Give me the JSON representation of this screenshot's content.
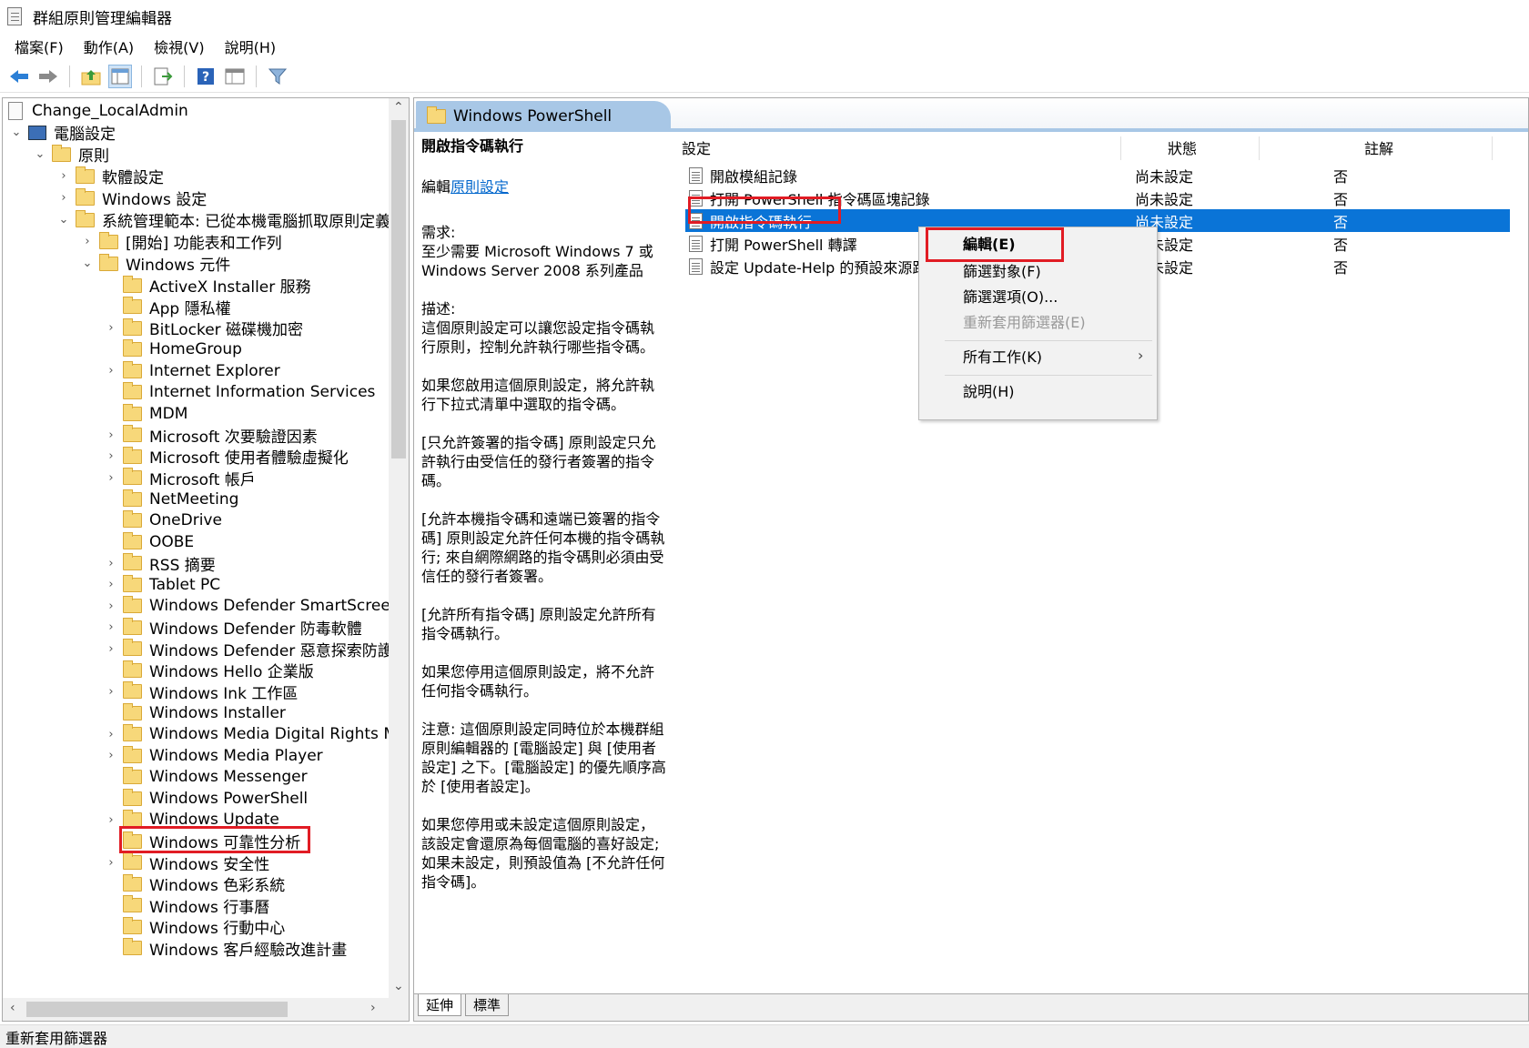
{
  "window": {
    "title": "群組原則管理編輯器"
  },
  "menu": {
    "items": [
      "檔案(F)",
      "動作(A)",
      "檢視(V)",
      "說明(H)"
    ]
  },
  "toolbar": {
    "buttons": [
      "back-icon",
      "forward-icon",
      "up-folder-icon",
      "show-hide-tree-icon",
      "export-list-icon",
      "help-icon",
      "properties-icon",
      "filter-icon"
    ]
  },
  "tree": {
    "root": "Change_LocalAdmin",
    "computer": "電腦設定",
    "policies": "原則",
    "software": "軟體設定",
    "windows_settings": "Windows 設定",
    "admin_templates": "系統管理範本: 已從本機電腦抓取原則定義",
    "start_menu": "[開始] 功能表和工作列",
    "windows_components": "Windows 元件",
    "components": [
      "ActiveX Installer 服務",
      "App 隱私權",
      "BitLocker 磁碟機加密",
      "HomeGroup",
      "Internet Explorer",
      "Internet Information Services",
      "MDM",
      "Microsoft 次要驗證因素",
      "Microsoft 使用者體驗虛擬化",
      "Microsoft 帳戶",
      "NetMeeting",
      "OneDrive",
      "OOBE",
      "RSS 摘要",
      "Tablet PC",
      "Windows Defender SmartScreen",
      "Windows Defender 防毒軟體",
      "Windows Defender 惡意探索防護",
      "Windows Hello 企業版",
      "Windows Ink 工作區",
      "Windows Installer",
      "Windows Media Digital Rights Management",
      "Windows Media Player",
      "Windows Messenger",
      "Windows PowerShell",
      "Windows Update",
      "Windows 可靠性分析",
      "Windows 安全性",
      "Windows 色彩系統",
      "Windows 行事曆",
      "Windows 行動中心",
      "Windows 客戶經驗改進計畫"
    ]
  },
  "right": {
    "header_title": "Windows PowerShell",
    "desc": {
      "title": "開啟指令碼執行",
      "edit_prefix": "編輯",
      "edit_link": "原則設定",
      "requirement_label": "需求:",
      "requirement": "至少需要 Microsoft Windows 7 或 Windows Server 2008 系列產品",
      "description_label": "描述:",
      "p1": "這個原則設定可以讓您設定指令碼執行原則，控制允許執行哪些指令碼。",
      "p2": "如果您啟用這個原則設定，將允許執行下拉式清單中選取的指令碼。",
      "p3": "[只允許簽署的指令碼] 原則設定只允許執行由受信任的發行者簽署的指令碼。",
      "p4": "[允許本機指令碼和遠端已簽署的指令碼] 原則設定允許任何本機的指令碼執行; 來自網際網路的指令碼則必須由受信任的發行者簽署。",
      "p5": "[允許所有指令碼] 原則設定允許所有指令碼執行。",
      "p6": "如果您停用這個原則設定，將不允許任何指令碼執行。",
      "p7": "注意: 這個原則設定同時位於本機群組原則編輯器的 [電腦設定] 與 [使用者設定] 之下。[電腦設定] 的優先順序高於 [使用者設定]。",
      "p8": "如果您停用或未設定這個原則設定，該設定會還原為每個電腦的喜好設定; 如果未設定，則預設值為 [不允許任何指令碼]。"
    },
    "columns": {
      "setting": "設定",
      "state": "狀態",
      "comment": "註解"
    },
    "rows": [
      {
        "name": "開啟模組記錄",
        "state": "尚未設定",
        "comment": "否"
      },
      {
        "name": "打開 PowerShell 指令碼區塊記錄",
        "state": "尚未設定",
        "comment": "否"
      },
      {
        "name": "開啟指令碼執行",
        "state": "尚未設定",
        "comment": "否"
      },
      {
        "name": "打開 PowerShell 轉譯",
        "state": "尚未設定",
        "comment": "否"
      },
      {
        "name": "設定 Update-Help 的預設來源路徑",
        "state": "尚未設定",
        "comment": "否"
      }
    ],
    "context_menu": {
      "edit": "編輯(E)",
      "filter_on": "篩選對象(F)",
      "filter_options": "篩選選項(O)...",
      "reapply": "重新套用篩選器(E)",
      "all_tasks": "所有工作(K)",
      "help": "說明(H)"
    },
    "tabs": [
      "延伸",
      "標準"
    ]
  },
  "statusbar": {
    "text": "重新套用篩選器"
  },
  "colors": {
    "selection": "#0a74d7",
    "highlight": "#e11c24",
    "header": "#a8c7e6"
  }
}
